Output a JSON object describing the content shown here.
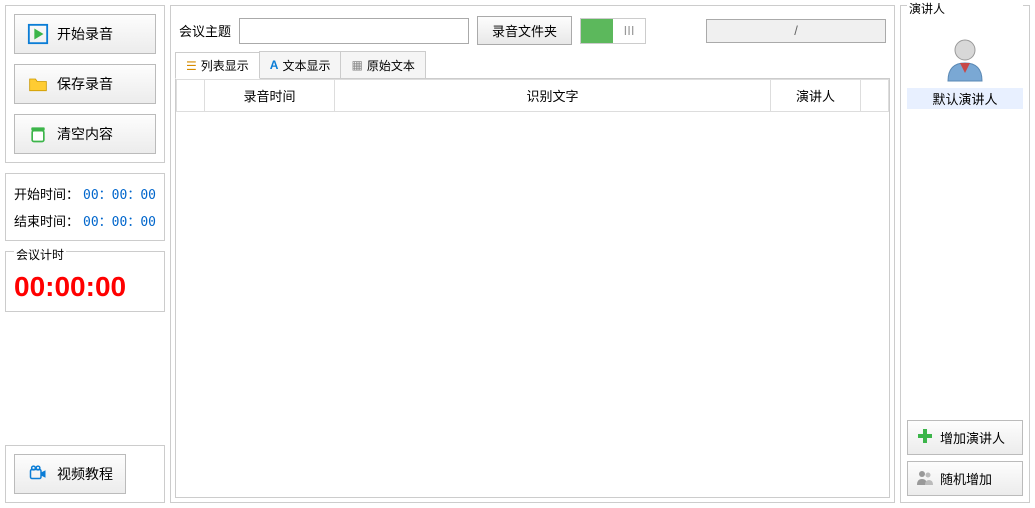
{
  "left": {
    "start_record": "开始录音",
    "save_record": "保存录音",
    "clear_content": "清空内容",
    "start_time_label": "开始时间：",
    "start_time": "00：00：00",
    "end_time_label": "结束时间：",
    "end_time": "00：00：00",
    "timer_label": "会议计时",
    "timer": "00:00:00",
    "tutorial": "视频教程"
  },
  "center": {
    "topic_label": "会议主题",
    "topic_value": "",
    "folder_btn": "录音文件夹",
    "progress": "/",
    "tabs": {
      "list": "列表显示",
      "text": "文本显示",
      "raw": "原始文本"
    },
    "columns": {
      "time": "录音时间",
      "text": "识别文字",
      "speaker": "演讲人"
    }
  },
  "right": {
    "group_label": "演讲人",
    "default_speaker": "默认演讲人",
    "add_speaker": "增加演讲人",
    "random_add": "随机增加"
  }
}
